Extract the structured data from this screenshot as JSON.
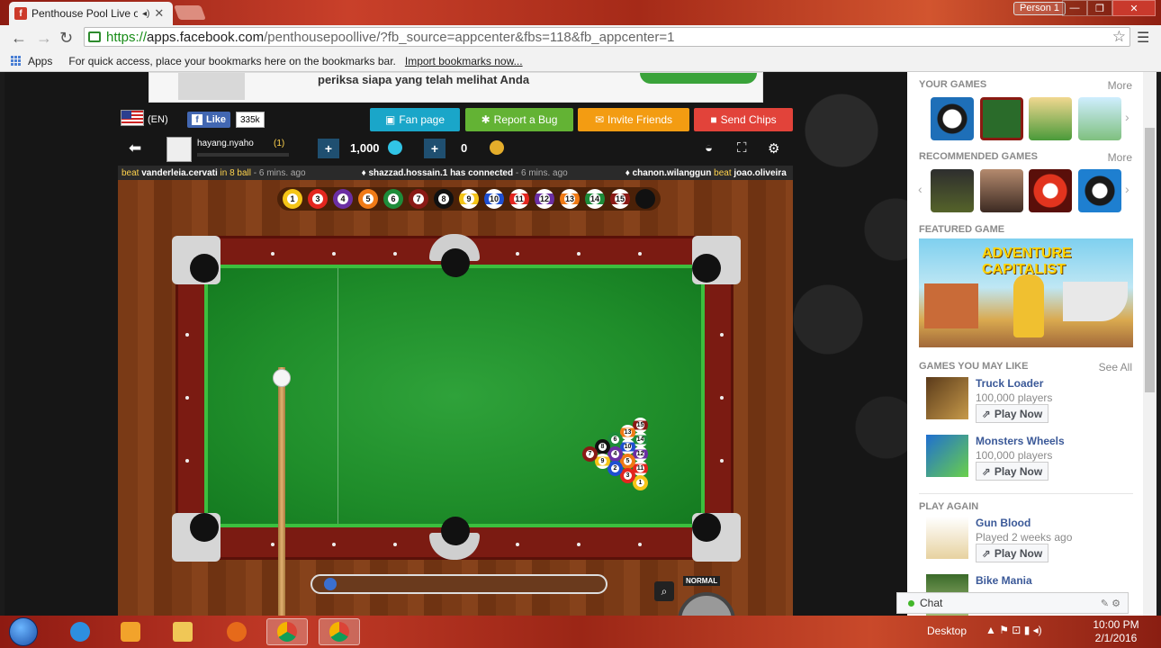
{
  "browser": {
    "tab_title": "Penthouse Pool Live on",
    "profile": "Person 1",
    "url_scheme": "https://",
    "url_host": "apps.facebook.com",
    "url_path": "/penthousepoollive/?fb_source=appcenter&fbs=118&fb_appcenter=1",
    "apps_label": "Apps",
    "bookmarks_message": "For quick access, place your bookmarks here on the bookmarks bar.",
    "import_link": "Import bookmarks now..."
  },
  "ad": {
    "text": "periksa siapa yang telah melihat Anda"
  },
  "topbar": {
    "lang": "(EN)",
    "like_label": "Like",
    "like_count": "335k",
    "fan_page": "Fan page",
    "report_bug": "Report a Bug",
    "invite_friends": "Invite Friends",
    "send_chips": "Send Chips"
  },
  "hud": {
    "username": "hayang.nyaho",
    "level": "(1)",
    "coins": "1,000",
    "cash": "0"
  },
  "ticker": {
    "a_beat": "beat",
    "a_user": "vanderleia.cervati",
    "a_game": "in 8 ball",
    "a_time": "- 6 mins. ago",
    "b_user": "shazzad.hossain.1",
    "b_msg": "has connected",
    "b_time": "- 6 mins. ago",
    "c_user": "chanon.wilanggun",
    "c_beat": "beat",
    "c_opp": "joao.oliveira"
  },
  "balls": [
    "1",
    "3",
    "4",
    "5",
    "6",
    "7",
    "8",
    "9",
    "10",
    "11",
    "12",
    "13",
    "14",
    "15"
  ],
  "rack": [
    "15",
    "14",
    "12",
    "11",
    "1",
    "13",
    "10",
    "5",
    "3",
    "6",
    "4",
    "2",
    "8",
    "9",
    "7"
  ],
  "game": {
    "normal_label": "NORMAL",
    "power_level": 0.03
  },
  "sidebar": {
    "your_games": "YOUR GAMES",
    "more": "More",
    "recommended": "RECOMMENDED GAMES",
    "featured": "FEATURED GAME",
    "featured_logo": "ADVENTURE CAPITALIST",
    "may_like": "GAMES YOU MAY LIKE",
    "see_all": "See All",
    "play_again": "PLAY AGAIN",
    "play_now": "Play Now",
    "games": [
      {
        "title": "Truck Loader",
        "sub": "100,000 players"
      },
      {
        "title": "Monsters Wheels",
        "sub": "100,000 players"
      }
    ],
    "again": [
      {
        "title": "Gun Blood",
        "sub": "Played 2 weeks ago"
      },
      {
        "title": "Bike Mania",
        "sub": ""
      }
    ],
    "chat": "Chat"
  },
  "taskbar": {
    "desktop": "Desktop",
    "time": "10:00 PM",
    "date": "2/1/2016"
  }
}
